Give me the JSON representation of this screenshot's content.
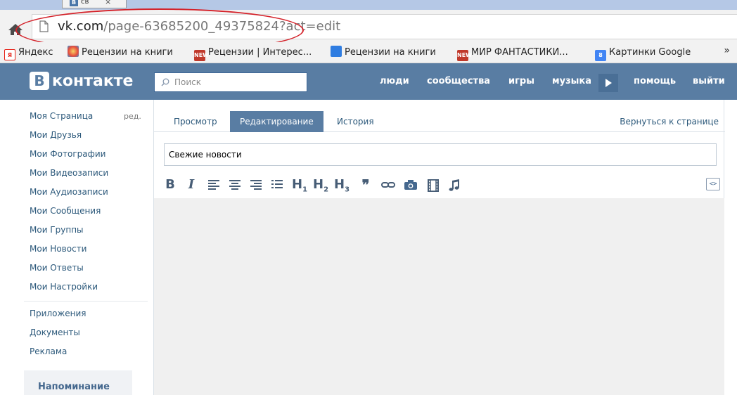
{
  "browser": {
    "tab_title": "св",
    "tab_close": "×",
    "tab_favicon": "В",
    "url_host": "vk.com",
    "url_path": "/page-63685200_49375824?act=edit",
    "bookmarks": [
      {
        "label": "Яндекс",
        "icon": "yandex-icon",
        "color": "#e62117"
      },
      {
        "label": "Рецензии на книги",
        "icon": "spinner-flower-icon",
        "color": "#f0a030"
      },
      {
        "label": "Рецензии | Интерес...",
        "icon": "new-it-icon",
        "color": "#c0392b"
      },
      {
        "label": "Рецензии на книги",
        "icon": "book-icon",
        "color": "#2f7de1"
      },
      {
        "label": "МИР ФАНТАСТИКИ...",
        "icon": "new-it-icon",
        "color": "#c0392b"
      },
      {
        "label": "Картинки Google",
        "icon": "google-icon",
        "color": "#4285f4"
      }
    ],
    "bookmarks_more": "»",
    "annotation_color": "#d4222a"
  },
  "vk": {
    "logo_letter": "В",
    "logo_text": "контакте",
    "search_placeholder": "Поиск",
    "nav": [
      "люди",
      "сообщества",
      "игры",
      "музыка",
      "помощь",
      "выйти"
    ],
    "brand_color": "#597da3"
  },
  "menu": {
    "items": [
      "Моя Страница",
      "Мои Друзья",
      "Мои Фотографии",
      "Мои Видеозаписи",
      "Мои Аудиозаписи",
      "Мои Сообщения",
      "Мои Группы",
      "Мои Новости",
      "Мои Ответы",
      "Мои Настройки"
    ],
    "edit_label": "ред.",
    "extra": [
      "Приложения",
      "Документы",
      "Реклама"
    ],
    "reminder": "Напоминание"
  },
  "editor": {
    "tabs": [
      "Просмотр",
      "Редактирование",
      "История"
    ],
    "active_tab": "Редактирование",
    "back_link": "Вернуться к странице",
    "title_value": "Свежие новости",
    "toolbar": {
      "bold": "B",
      "italic": "I",
      "h1": "H",
      "h2": "H",
      "h3": "H",
      "h1_sub": "1",
      "h2_sub": "2",
      "h3_sub": "3",
      "quote": "❞",
      "source": "<>"
    }
  }
}
